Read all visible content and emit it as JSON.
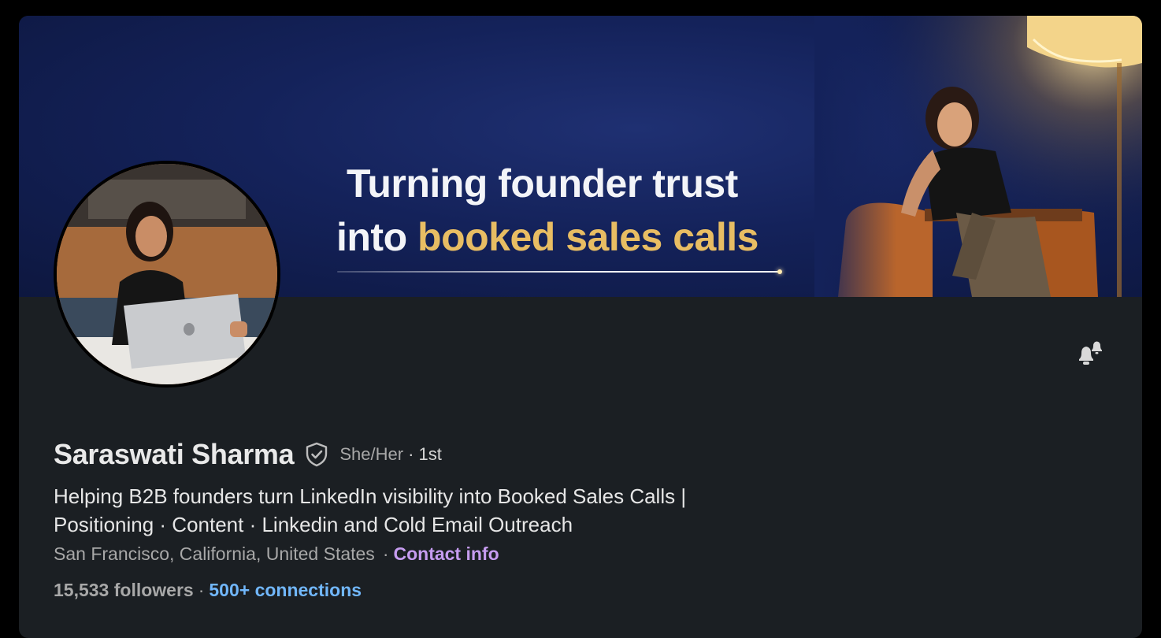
{
  "banner": {
    "line1": "Turning founder trust",
    "line2_prefix": "into ",
    "line2_highlight": "booked sales calls",
    "highlight_color": "#e8bd63"
  },
  "profile": {
    "name": "Saraswati Sharma",
    "verified_icon": "shield-check-icon",
    "pronouns": "She/Her",
    "degree": "· 1st",
    "headline": "Helping B2B founders turn LinkedIn visibility into Booked Sales Calls | Positioning · Content · Linkedin and Cold Email Outreach",
    "location": "San Francisco, California, United States",
    "location_separator": "·",
    "contact_info_label": "Contact info",
    "followers": "15,533 followers",
    "follow_separator": "·",
    "connections": "500+ connections"
  },
  "actions": {
    "notification_icon": "bell-icon"
  },
  "colors": {
    "page_background": "#000000",
    "card_background": "#1b1f23",
    "link_purple": "#c69cf0",
    "link_blue": "#71b7fb"
  }
}
